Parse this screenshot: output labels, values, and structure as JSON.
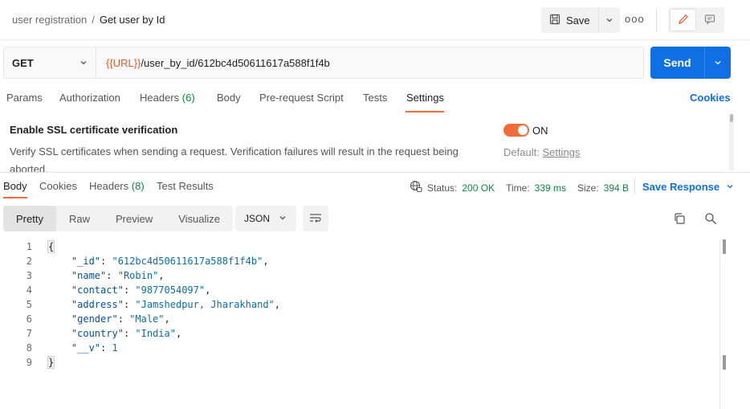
{
  "header": {
    "collection": "user registration",
    "separator": "/",
    "request_name": "Get user by Id",
    "save_label": "Save",
    "more_label": "ooo"
  },
  "request": {
    "method": "GET",
    "url_var": "{{URL}}",
    "url_path": "/user_by_id/612bc4d50611617a588f1f4b",
    "send_label": "Send"
  },
  "request_tabs": {
    "params": "Params",
    "authorization": "Authorization",
    "headers": "Headers",
    "headers_count": "(6)",
    "body": "Body",
    "prerequest": "Pre-request Script",
    "tests": "Tests",
    "settings": "Settings",
    "cookies": "Cookies"
  },
  "settings": {
    "title": "Enable SSL certificate verification",
    "description": "Verify SSL certificates when sending a request. Verification failures will result in the request being aborted.",
    "toggle_label": "ON",
    "default_prefix": "Default:",
    "default_link": "Settings"
  },
  "response_tabs": {
    "body": "Body",
    "cookies": "Cookies",
    "headers": "Headers",
    "headers_count": "(8)",
    "test_results": "Test Results"
  },
  "response_meta": {
    "status_label": "Status:",
    "status_value": "200 OK",
    "time_label": "Time:",
    "time_value": "339 ms",
    "size_label": "Size:",
    "size_value": "394 B",
    "save_response": "Save Response"
  },
  "view": {
    "pretty": "Pretty",
    "raw": "Raw",
    "preview": "Preview",
    "visualize": "Visualize",
    "format": "JSON"
  },
  "code": {
    "line_numbers": [
      "1",
      "2",
      "3",
      "4",
      "5",
      "6",
      "7",
      "8",
      "9"
    ],
    "open_brace": "{",
    "close_brace": "}",
    "fields": [
      {
        "key": "\"_id\"",
        "value": "\"612bc4d50611617a588f1f4b\"",
        "tail": ","
      },
      {
        "key": "\"name\"",
        "value": "\"Robin\"",
        "tail": ","
      },
      {
        "key": "\"contact\"",
        "value": "\"9877054097\"",
        "tail": ","
      },
      {
        "key": "\"address\"",
        "value": "\"Jamshedpur, Jharakhand\"",
        "tail": ","
      },
      {
        "key": "\"gender\"",
        "value": "\"Male\"",
        "tail": ","
      },
      {
        "key": "\"country\"",
        "value": "\"India\"",
        "tail": ","
      },
      {
        "key": "\"__v\"",
        "value": "1",
        "tail": ""
      }
    ]
  },
  "colors": {
    "accent": "#f26b3a",
    "primary": "#0f6fe3",
    "success": "#0b8a3e",
    "url_variable": "#e4572e"
  },
  "icons": [
    "save-icon",
    "chevron-down-icon",
    "edit-icon",
    "comment-icon",
    "globe-icon",
    "wrap-icon",
    "copy-icon",
    "search-icon"
  ]
}
